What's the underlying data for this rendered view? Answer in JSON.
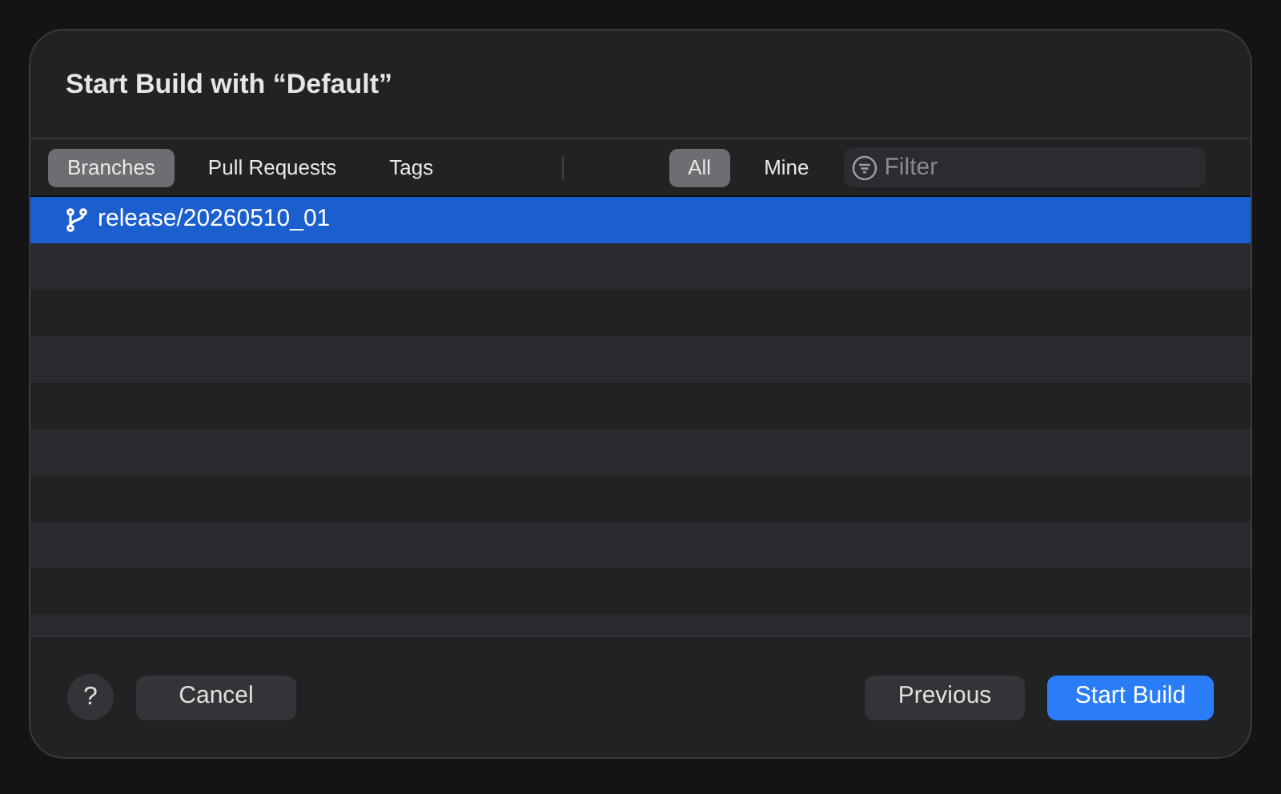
{
  "dialog": {
    "title": "Start Build with “Default”"
  },
  "source_tabs": [
    {
      "label": "Branches",
      "selected": true
    },
    {
      "label": "Pull Requests",
      "selected": false
    },
    {
      "label": "Tags",
      "selected": false
    }
  ],
  "owner_tabs": [
    {
      "label": "All",
      "selected": true
    },
    {
      "label": "Mine",
      "selected": false
    }
  ],
  "filter": {
    "placeholder": "Filter"
  },
  "branches": [
    {
      "name": "release/20260510_01",
      "selected": true
    }
  ],
  "buttons": {
    "help": "?",
    "cancel": "Cancel",
    "previous": "Previous",
    "start": "Start Build"
  }
}
